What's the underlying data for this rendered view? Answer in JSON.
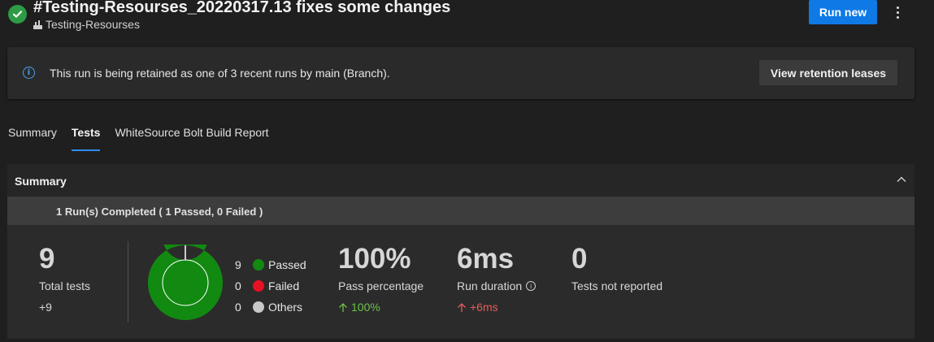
{
  "header": {
    "title": "#Testing-Resourses_20220317.13 fixes some changes",
    "pipeline": "Testing-Resourses",
    "run_new_label": "Run new"
  },
  "banner": {
    "text": "This run is being retained as one of 3 recent runs by main (Branch).",
    "button_label": "View retention leases"
  },
  "tabs": [
    {
      "label": "Summary",
      "active": false
    },
    {
      "label": "Tests",
      "active": true
    },
    {
      "label": "WhiteSource Bolt Build Report",
      "active": false
    }
  ],
  "summary": {
    "title": "Summary",
    "runs_text": "1 Run(s) Completed ( 1 Passed, 0 Failed )",
    "total_tests": {
      "value": "9",
      "label": "Total tests",
      "delta": "+9"
    },
    "outcomes": [
      {
        "count": "9",
        "label": "Passed",
        "color": "#128a12",
        "value": 9
      },
      {
        "count": "0",
        "label": "Failed",
        "color": "#e81123",
        "value": 0
      },
      {
        "count": "0",
        "label": "Others",
        "color": "#c8c8c8",
        "value": 0
      }
    ],
    "pass_percentage": {
      "value": "100%",
      "label": "Pass percentage",
      "delta": "100%"
    },
    "run_duration": {
      "value": "6ms",
      "label": "Run duration",
      "delta": "+6ms"
    },
    "not_reported": {
      "value": "0",
      "label": "Tests not reported"
    }
  },
  "colors": {
    "accent": "#0f7ae5",
    "success": "#2e9b46",
    "trend_good": "#6cc24a",
    "trend_bad": "#e85b5b"
  },
  "icons": {
    "status": "check-circle-icon",
    "pipeline": "pipeline-icon",
    "banner": "info-icon",
    "more": "more-vertical-icon",
    "collapse": "chevron-up-icon",
    "duration_info": "info-icon"
  }
}
